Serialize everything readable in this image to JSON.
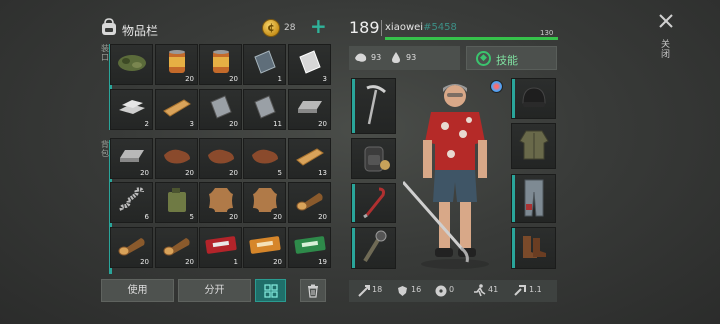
{
  "inventory": {
    "title": "物品栏",
    "coins": "28",
    "add_symbol": "+",
    "hands_label": "装口",
    "backpack_label": "背包",
    "slots": [
      {
        "icon": "camo-backpack-icon",
        "qty": ""
      },
      {
        "icon": "canned-food-icon",
        "qty": "20"
      },
      {
        "icon": "canned-food-icon",
        "qty": "20"
      },
      {
        "icon": "dark-metal-plate-icon",
        "qty": "1"
      },
      {
        "icon": "steel-plate-icon",
        "qty": "3"
      },
      {
        "icon": "iron-bars-icon",
        "qty": "2"
      },
      {
        "icon": "wooden-plank-icon",
        "qty": "3"
      },
      {
        "icon": "metal-plate-icon",
        "qty": "20"
      },
      {
        "icon": "metal-plate-icon",
        "qty": "11"
      },
      {
        "icon": "iron-ingot-icon",
        "qty": "20"
      },
      {
        "icon": "iron-ingot-icon",
        "qty": "20"
      },
      {
        "icon": "leather-icon",
        "qty": "20"
      },
      {
        "icon": "leather-icon",
        "qty": "20"
      },
      {
        "icon": "leather-icon",
        "qty": "5"
      },
      {
        "icon": "wooden-plank-icon",
        "qty": "13"
      },
      {
        "icon": "spring-icon",
        "qty": "6"
      },
      {
        "icon": "fuel-canister-icon",
        "qty": "5"
      },
      {
        "icon": "animal-hide-icon",
        "qty": "20"
      },
      {
        "icon": "animal-hide-icon",
        "qty": "20"
      },
      {
        "icon": "log-icon",
        "qty": "20"
      },
      {
        "icon": "log-icon",
        "qty": "20"
      },
      {
        "icon": "log-icon",
        "qty": "20"
      },
      {
        "icon": "red-ticket-icon",
        "qty": "1"
      },
      {
        "icon": "orange-ticket-icon",
        "qty": "20"
      },
      {
        "icon": "green-ticket-icon",
        "qty": "19"
      }
    ],
    "buttons": {
      "use": "使用",
      "split": "分开"
    }
  },
  "character": {
    "level": "189",
    "name": "xiaowei",
    "id": "#5458",
    "hp_value": "130",
    "hp_fraction": 1.0,
    "food": "93",
    "water": "93",
    "skills_label": "技能",
    "equipment": {
      "weapon": "pickaxe-icon",
      "backpack": "tactical-backpack-icon",
      "tool": "crowbar-icon",
      "melee": "spiked-club-icon",
      "head": "beanie-icon",
      "body": "jacket-icon",
      "legs": "pants-icon",
      "feet": "boots-icon"
    },
    "stats": {
      "attack": "18",
      "defense": "16",
      "radiation": "0",
      "speed": "41",
      "crit": "1.1"
    }
  },
  "close_label": "关闭",
  "colors": {
    "accent": "#2aa59a",
    "hp": "#36c24b",
    "coin": "#e0b13a",
    "skills": "#3bc46e"
  }
}
